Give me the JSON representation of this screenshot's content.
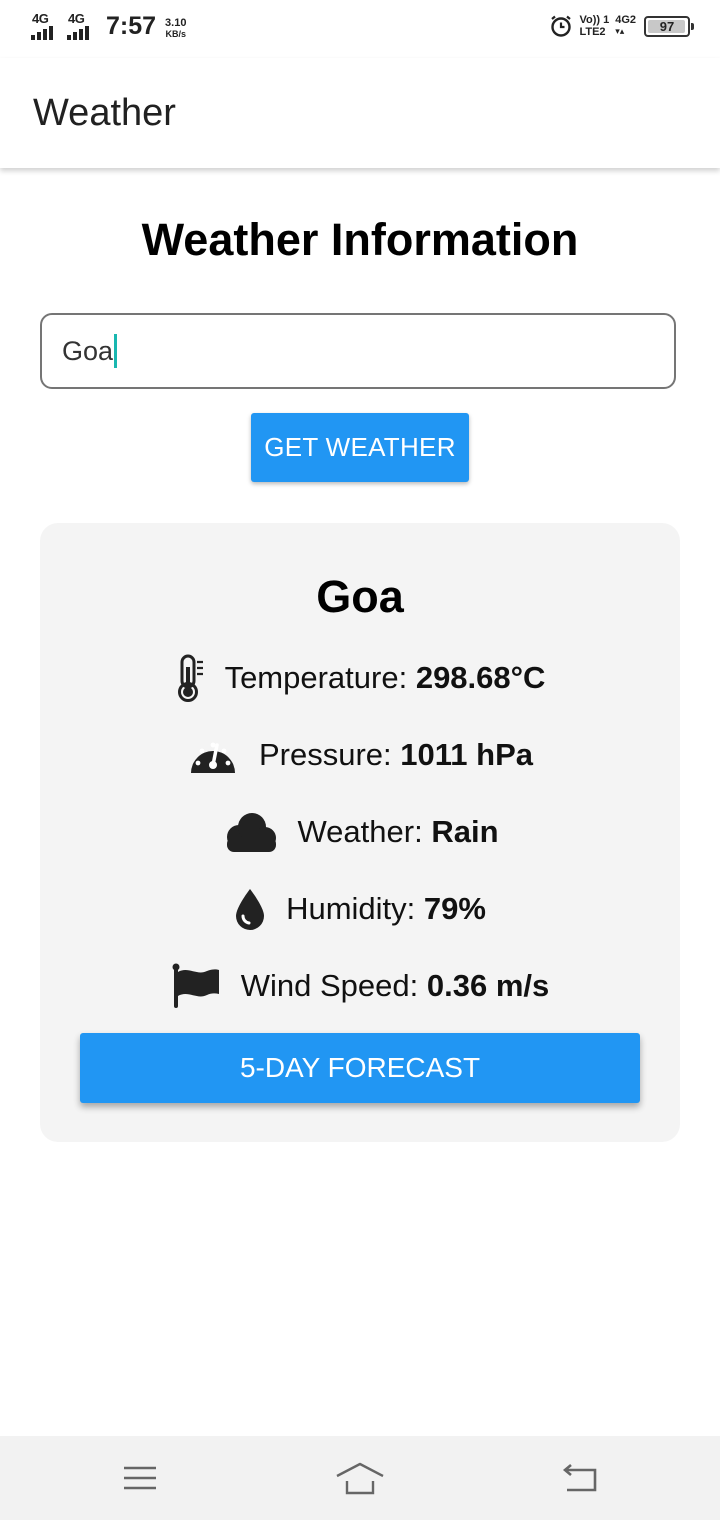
{
  "status_bar": {
    "network_1": "4G",
    "network_2": "4G",
    "time": "7:57",
    "speed_value": "3.10",
    "speed_unit": "KB/s",
    "volte_top": "Vo)) 1",
    "volte_bottom": "LTE2",
    "network_3": "4G2",
    "battery_level": "97",
    "battery_fraction": 0.97,
    "icons": [
      "signal-icon",
      "alarm-icon",
      "battery-icon"
    ]
  },
  "app_bar": {
    "title": "Weather"
  },
  "page": {
    "title": "Weather Information"
  },
  "search": {
    "value": "Goa"
  },
  "actions": {
    "get_weather": "GET WEATHER",
    "forecast": "5-DAY FORECAST"
  },
  "weather": {
    "city": "Goa",
    "temperature": {
      "label": "Temperature:",
      "value": "298.68°C",
      "icon": "thermometer-icon"
    },
    "pressure": {
      "label": "Pressure:",
      "value": "1011 hPa",
      "icon": "gauge-icon"
    },
    "condition": {
      "label": "Weather:",
      "value": "Rain",
      "icon": "cloud-icon"
    },
    "humidity": {
      "label": "Humidity:",
      "value": "79%",
      "icon": "droplet-icon"
    },
    "wind": {
      "label": "Wind Speed:",
      "value": "0.36 m/s",
      "icon": "flag-icon"
    }
  },
  "nav_bar": {
    "icons": [
      "menu-icon",
      "home-icon",
      "back-icon"
    ]
  },
  "colors": {
    "accent": "#2196f3",
    "card": "#f4f4f4",
    "caret": "#19b7b0"
  }
}
